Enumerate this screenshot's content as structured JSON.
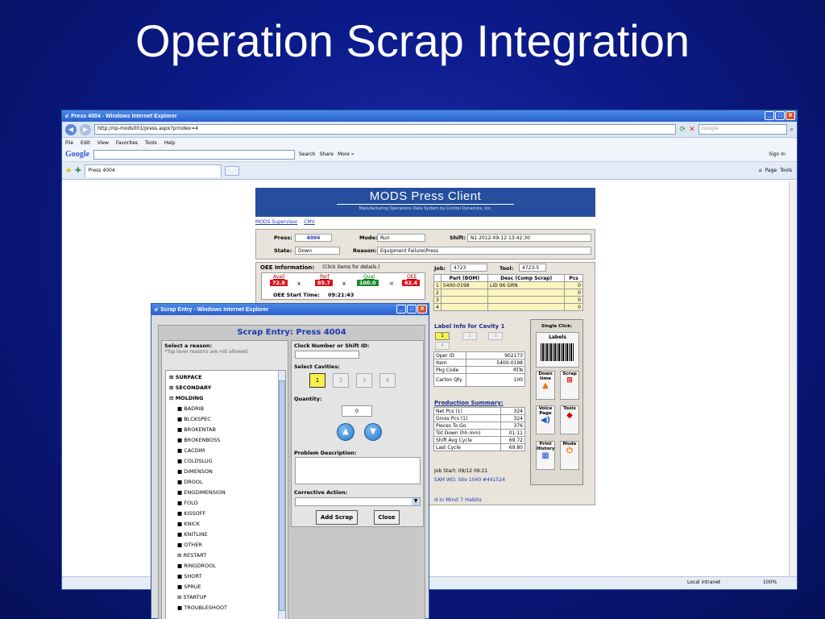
{
  "slide": {
    "title": "Operation Scrap Integration"
  },
  "browser": {
    "window_title": "Press 4004 - Windows Internet Explorer",
    "address": "http://np-mods001/press.aspx?prindex=4",
    "search_placeholder": "Google",
    "menu": [
      "File",
      "Edit",
      "View",
      "Favorites",
      "Tools",
      "Help"
    ],
    "google_logo": "Google",
    "google_search_label": "Search",
    "share_label": "Share",
    "more_label": "More »",
    "sign_in": "Sign In",
    "tab_title": "Press 4004",
    "page_menu": "Page",
    "tools_menu": "Tools",
    "status_zone": "Local intranet",
    "zoom": "100%"
  },
  "mods": {
    "title": "MODS Press Client",
    "subtitle": "Manufacturing Operations Data System    by Control Dynamics, Inc.",
    "links": [
      "MODS Supervisor",
      "CMV"
    ],
    "press_label": "Press:",
    "press_value": "4004",
    "mode_label": "Mode:",
    "mode_value": "Run",
    "shift_label": "Shift:",
    "shift_value": "N1 2012-09-12 13:42:30",
    "state_label": "State:",
    "state_value": "Down",
    "reason_label": "Reason:",
    "reason_value": "Equipment Failure\\Press",
    "oee_info_label": "OEE Information:",
    "oee_info_hint": "(Click items for details.)",
    "oee": {
      "avail_label": "Avail",
      "avail_value": "72.8",
      "perf_label": "Perf",
      "perf_value": "85.7",
      "qual_label": "Qual",
      "qual_value": "100.0",
      "oee_label": "OEE",
      "oee_value": "62.4",
      "times": "x",
      "equals": "="
    },
    "oee_start_label": "OEE Start Time:",
    "oee_start_value": "09:21:43",
    "job_label": "Job:",
    "job_value": "4723",
    "tool_label": "Tool:",
    "tool_value": "4723-5",
    "parts_table": {
      "headers": [
        "Part (BOM)",
        "Desc (Comp Scrap)",
        "Pcs"
      ],
      "rows": [
        {
          "num": "1",
          "part": "5400-0198",
          "desc": "LID 96 GRN",
          "pcs": "0"
        },
        {
          "num": "2",
          "part": "",
          "desc": "",
          "pcs": "0"
        },
        {
          "num": "3",
          "part": "",
          "desc": "",
          "pcs": "0"
        },
        {
          "num": "4",
          "part": "",
          "desc": "",
          "pcs": "0"
        }
      ]
    },
    "label_info_title": "Label Info for Cavity 1",
    "label_cavities": [
      "1",
      "2",
      "3",
      "4"
    ],
    "label_fields": [
      {
        "k": "Oper ID",
        "v": "902173"
      },
      {
        "k": "Item",
        "v": "5400-0198"
      },
      {
        "k": "Pkg Code",
        "v": "RTN"
      },
      {
        "k": "Carton Qty",
        "v": "100"
      }
    ],
    "production_title": "Production Summary:",
    "production": [
      {
        "k": "Net Pcs (1)",
        "v": "324"
      },
      {
        "k": "Gross Pcs (1)",
        "v": "324"
      },
      {
        "k": "Pieces To Go",
        "v": "376"
      },
      {
        "k": "Tot Down (hh:mm)",
        "v": "01:11"
      },
      {
        "k": "Shift Avg Cycle",
        "v": "69.72"
      },
      {
        "k": "Last Cycle",
        "v": "69.80"
      }
    ],
    "job_start": "Job Start:  09/12 09:21",
    "eam_wo": "EAM WO: Site 1040 #441524",
    "footer_text": "d in Mind 7 Habits",
    "single_click_label": "Single Click:",
    "labels_button": "Labels",
    "tiles": {
      "downtime": "Down time",
      "scrap": "Scrap",
      "voice": "Voice Page",
      "tools": "Tools",
      "print": "Print History",
      "mode": "Mode"
    }
  },
  "scrap_dialog": {
    "window_title": "Scrap Entry - Windows Internet Explorer",
    "heading": "Scrap Entry: Press 4004",
    "select_reason": "Select a reason:",
    "reason_note": "*Top level reasons are not allowed.",
    "reasons_top": [
      "SURFACE",
      "SECONDARY",
      "MOLDING"
    ],
    "reasons": [
      "BADRIB",
      "BLCKSPEC",
      "BROKENTAB",
      "BROKENBOSS",
      "CACDIM",
      "COLDSLUG",
      "DIMENSON",
      "DROOL",
      "ENGDIMENSION",
      "FOLD",
      "KISSOFF",
      "KNICK",
      "KNITLINE",
      "OTHER",
      "RESTART",
      "RINGDROOL",
      "SHORT",
      "SPRUE",
      "STARTUP",
      "TROUBLESHOOT"
    ],
    "clock_label": "Clock Number or Shift ID:",
    "cavities_label": "Select Cavities:",
    "cavities": [
      "1",
      "2",
      "3",
      "4"
    ],
    "quantity_label": "Quantity:",
    "quantity_value": "0",
    "problem_label": "Problem Description:",
    "corrective_label": "Corrective Action:",
    "add_button": "Add Scrap",
    "close_button": "Close"
  }
}
